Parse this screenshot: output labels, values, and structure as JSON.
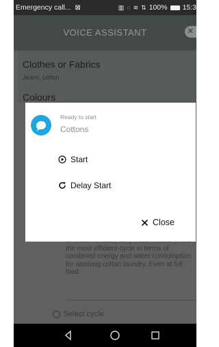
{
  "status_bar": {
    "carrier": "Emergency call...",
    "battery": "100%",
    "time": "15:3"
  },
  "header": {
    "title": "VOICE ASSISTANT"
  },
  "background": {
    "section1_title": "Clothes or Fabrics",
    "section1_value": "Jeans, cotton",
    "section2_title": "Colours",
    "description": "to clean normally dirty cotton laundry. It is the most efficient cycle in terms of combined energy and water consumption for washing cotton laundry. Even at full load",
    "select_cycle": "Select cycle"
  },
  "dialog": {
    "status": "Ready to start",
    "program": "Cottons",
    "start_label": "Start",
    "delay_start_label": "Delay Start",
    "close_label": "Close"
  },
  "colors": {
    "accent": "#1fa6df",
    "overlay": "#606060"
  }
}
